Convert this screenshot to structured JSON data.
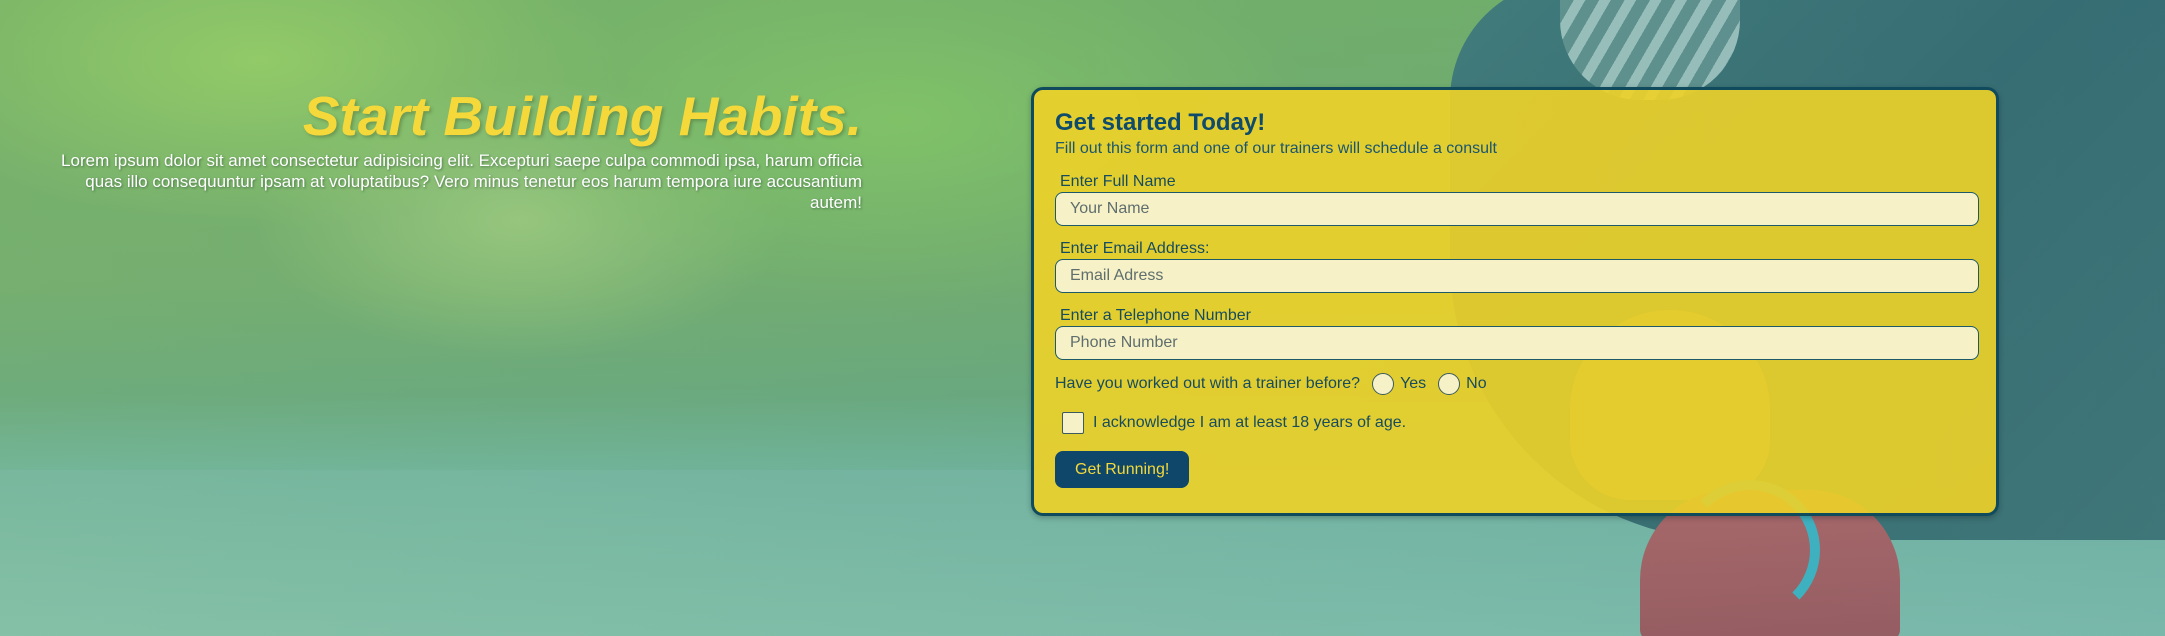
{
  "hero": {
    "headline": "Start Building Habits.",
    "lede": "Lorem ipsum dolor sit amet consectetur adipisicing elit. Excepturi saepe culpa commodi ipsa, harum officia quas illo consequuntur ipsam at voluptatibus? Vero minus tenetur eos harum tempora iure accusantium autem!"
  },
  "form": {
    "title": "Get started Today!",
    "subtitle": "Fill out this form and one of our trainers will schedule a consult",
    "fields": [
      {
        "label": "Enter Full Name",
        "placeholder": "Your Name",
        "value": ""
      },
      {
        "label": "Enter Email Address:",
        "placeholder": "Email Adress",
        "value": ""
      },
      {
        "label": "Enter a Telephone Number",
        "placeholder": "Phone Number",
        "value": ""
      }
    ],
    "trainer_question": "Have you worked out with a trainer before?",
    "options": [
      "Yes",
      "No"
    ],
    "acknowledge": "I acknowledge I am at least 18 years of age.",
    "submit_label": "Get Running!"
  },
  "colors": {
    "accent_yellow": "#f5d93a",
    "navy": "#0e476a",
    "card_bg": "#eed228"
  }
}
